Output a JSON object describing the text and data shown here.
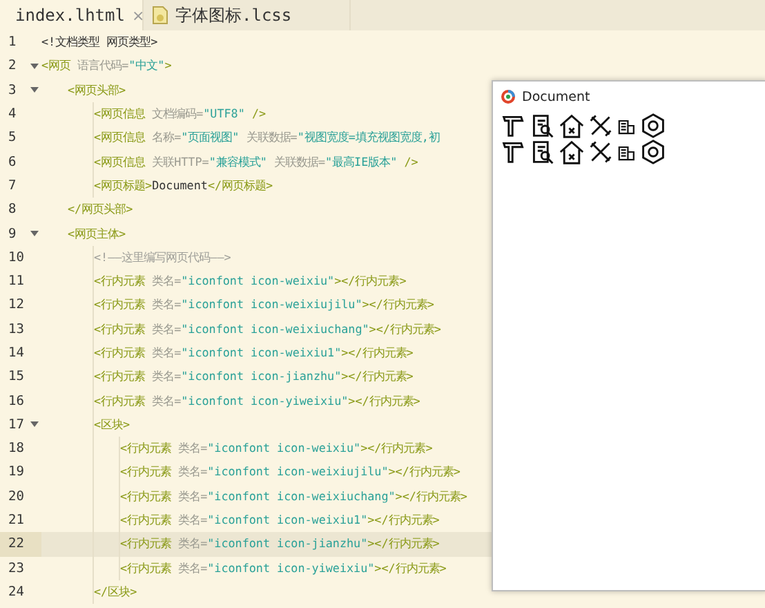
{
  "tabs": [
    {
      "label": "index.lhtml",
      "selected": true,
      "close": "×"
    },
    {
      "label": "字体图标.lcss",
      "selected": false
    }
  ],
  "lines": [
    {
      "number": "1",
      "tokens": [
        {
          "kind": "text",
          "text": "<!文档类型 网页类型>"
        }
      ]
    },
    {
      "number": "2",
      "expanded": true,
      "tokens": [
        {
          "kind": "tag",
          "text": "<网页"
        },
        {
          "kind": "attr",
          "text": " 语言代码="
        },
        {
          "kind": "string",
          "text": "\"中文\""
        },
        {
          "kind": "tag",
          "text": ">"
        }
      ],
      "children": [
        {
          "number": "3",
          "expanded": true,
          "tokens": [
            {
              "kind": "tag",
              "text": "<网页头部>"
            }
          ],
          "children": [
            {
              "number": "4",
              "tokens": [
                {
                  "kind": "tag",
                  "text": "<网页信息"
                },
                {
                  "kind": "attr",
                  "text": " 文档编码="
                },
                {
                  "kind": "string",
                  "text": "\"UTF8\""
                },
                {
                  "kind": "tag",
                  "text": " />"
                }
              ]
            },
            {
              "number": "5",
              "tokens": [
                {
                  "kind": "tag",
                  "text": "<网页信息"
                },
                {
                  "kind": "attr",
                  "text": " 名称="
                },
                {
                  "kind": "string",
                  "text": "\"页面视图\""
                },
                {
                  "kind": "attr",
                  "text": " 关联数据="
                },
                {
                  "kind": "string",
                  "text": "\"视图宽度=填充视图宽度,初"
                }
              ]
            },
            {
              "number": "6",
              "tokens": [
                {
                  "kind": "tag",
                  "text": "<网页信息"
                },
                {
                  "kind": "attr",
                  "text": " 关联HTTP="
                },
                {
                  "kind": "string",
                  "text": "\"兼容模式\""
                },
                {
                  "kind": "attr",
                  "text": " 关联数据="
                },
                {
                  "kind": "string",
                  "text": "\"最高IE版本\""
                },
                {
                  "kind": "tag",
                  "text": " />"
                }
              ]
            },
            {
              "number": "7",
              "tokens": [
                {
                  "kind": "tag",
                  "text": "<网页标题>"
                },
                {
                  "kind": "text",
                  "text": "Document"
                },
                {
                  "kind": "tag",
                  "text": "</网页标题>"
                }
              ]
            }
          ]
        },
        {
          "number": "8",
          "tokens": [
            {
              "kind": "tag",
              "text": "</网页头部>"
            }
          ]
        },
        {
          "number": "9",
          "expanded": true,
          "tokens": [
            {
              "kind": "tag",
              "text": "<网页主体>"
            }
          ],
          "children": [
            {
              "number": "10",
              "tokens": [
                {
                  "kind": "comment",
                  "text": "<!——这里编写网页代码——>"
                }
              ]
            },
            {
              "number": "11",
              "tokens": [
                {
                  "kind": "tag",
                  "text": "<行内元素"
                },
                {
                  "kind": "attr",
                  "text": " 类名="
                },
                {
                  "kind": "string",
                  "text": "\"iconfont icon-weixiu\""
                },
                {
                  "kind": "tag",
                  "text": "></行内元素>"
                }
              ]
            },
            {
              "number": "12",
              "tokens": [
                {
                  "kind": "tag",
                  "text": "<行内元素"
                },
                {
                  "kind": "attr",
                  "text": " 类名="
                },
                {
                  "kind": "string",
                  "text": "\"iconfont icon-weixiujilu\""
                },
                {
                  "kind": "tag",
                  "text": "></行内元素>"
                }
              ]
            },
            {
              "number": "13",
              "tokens": [
                {
                  "kind": "tag",
                  "text": "<行内元素"
                },
                {
                  "kind": "attr",
                  "text": " 类名="
                },
                {
                  "kind": "string",
                  "text": "\"iconfont icon-weixiuchang\""
                },
                {
                  "kind": "tag",
                  "text": "></行内元素>"
                }
              ]
            },
            {
              "number": "14",
              "tokens": [
                {
                  "kind": "tag",
                  "text": "<行内元素"
                },
                {
                  "kind": "attr",
                  "text": " 类名="
                },
                {
                  "kind": "string",
                  "text": "\"iconfont icon-weixiu1\""
                },
                {
                  "kind": "tag",
                  "text": "></行内元素>"
                }
              ]
            },
            {
              "number": "15",
              "tokens": [
                {
                  "kind": "tag",
                  "text": "<行内元素"
                },
                {
                  "kind": "attr",
                  "text": " 类名="
                },
                {
                  "kind": "string",
                  "text": "\"iconfont icon-jianzhu\""
                },
                {
                  "kind": "tag",
                  "text": "></行内元素>"
                }
              ]
            },
            {
              "number": "16",
              "tokens": [
                {
                  "kind": "tag",
                  "text": "<行内元素"
                },
                {
                  "kind": "attr",
                  "text": " 类名="
                },
                {
                  "kind": "string",
                  "text": "\"iconfont icon-yiweixiu\""
                },
                {
                  "kind": "tag",
                  "text": "></行内元素>"
                }
              ]
            },
            {
              "number": "17",
              "expanded": true,
              "tokens": [
                {
                  "kind": "tag",
                  "text": "<区块>"
                }
              ],
              "children": [
                {
                  "number": "18",
                  "tokens": [
                    {
                      "kind": "tag",
                      "text": "<行内元素"
                    },
                    {
                      "kind": "attr",
                      "text": " 类名="
                    },
                    {
                      "kind": "string",
                      "text": "\"iconfont icon-weixiu\""
                    },
                    {
                      "kind": "tag",
                      "text": "></行内元素>"
                    }
                  ]
                },
                {
                  "number": "19",
                  "tokens": [
                    {
                      "kind": "tag",
                      "text": "<行内元素"
                    },
                    {
                      "kind": "attr",
                      "text": " 类名="
                    },
                    {
                      "kind": "string",
                      "text": "\"iconfont icon-weixiujilu\""
                    },
                    {
                      "kind": "tag",
                      "text": "></行内元素>"
                    }
                  ]
                },
                {
                  "number": "20",
                  "tokens": [
                    {
                      "kind": "tag",
                      "text": "<行内元素"
                    },
                    {
                      "kind": "attr",
                      "text": " 类名="
                    },
                    {
                      "kind": "string",
                      "text": "\"iconfont icon-weixiuchang\""
                    },
                    {
                      "kind": "tag",
                      "text": "></行内元素>"
                    }
                  ]
                },
                {
                  "number": "21",
                  "tokens": [
                    {
                      "kind": "tag",
                      "text": "<行内元素"
                    },
                    {
                      "kind": "attr",
                      "text": " 类名="
                    },
                    {
                      "kind": "string",
                      "text": "\"iconfont icon-weixiu1\""
                    },
                    {
                      "kind": "tag",
                      "text": "></行内元素>"
                    }
                  ]
                },
                {
                  "number": "22",
                  "current": true,
                  "tokens": [
                    {
                      "kind": "tag",
                      "text": "<行内元素"
                    },
                    {
                      "kind": "attr",
                      "text": " 类名="
                    },
                    {
                      "kind": "string",
                      "text": "\"iconfont icon-jianzhu\""
                    },
                    {
                      "kind": "tag",
                      "text": "></行内元素>"
                    }
                  ]
                },
                {
                  "number": "23",
                  "tokens": [
                    {
                      "kind": "tag",
                      "text": "<行内元素"
                    },
                    {
                      "kind": "attr",
                      "text": " 类名="
                    },
                    {
                      "kind": "string",
                      "text": "\"iconfont icon-yiweixiu\""
                    },
                    {
                      "kind": "tag",
                      "text": "></行内元素>"
                    }
                  ]
                }
              ]
            },
            {
              "number": "24",
              "tokens": [
                {
                  "kind": "tag",
                  "text": "</区块>"
                }
              ]
            }
          ]
        }
      ]
    }
  ],
  "preview": {
    "title": "Document"
  }
}
